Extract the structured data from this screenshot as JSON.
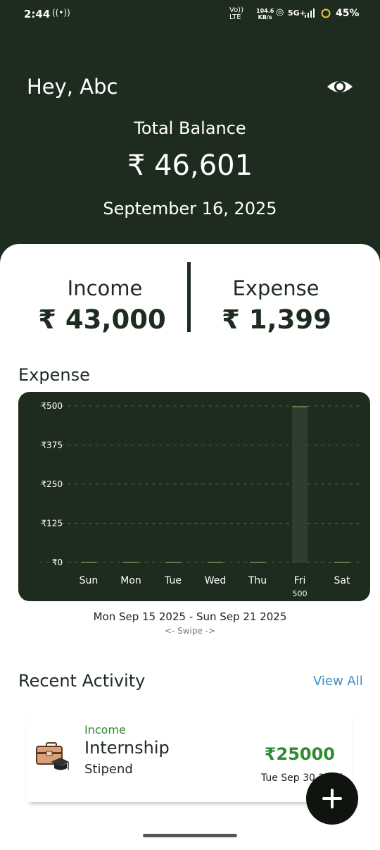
{
  "status_bar": {
    "time": "2:44",
    "network_top": "Vo))",
    "network_bottom": "LTE",
    "speed_top": "104.6",
    "speed_bottom": "KB/s",
    "network_type": "5G+",
    "battery": "45%",
    "icons": [
      "cast-icon",
      "hotspot-icon",
      "signal-bars-icon",
      "battery-ring-icon"
    ]
  },
  "header": {
    "greeting": "Hey, Abc",
    "total_balance_label": "Total Balance",
    "total_balance": "₹ 46,601",
    "date": "September 16, 2025",
    "icon": "eye-icon"
  },
  "summary": {
    "income_label": "Income",
    "income_amount": "₹ 43,000",
    "expense_label": "Expense",
    "expense_amount": "₹ 1,399"
  },
  "expense_section": {
    "title": "Expense",
    "week_range": "Mon Sep 15 2025 - Sun Sep 21 2025",
    "swipe_hint": "<- Swipe ->"
  },
  "chart_data": {
    "type": "bar",
    "categories": [
      "Sun",
      "Mon",
      "Tue",
      "Wed",
      "Thu",
      "Fri",
      "Sat"
    ],
    "values": [
      0,
      0,
      0,
      0,
      0,
      500,
      0
    ],
    "y_ticks": [
      "₹0",
      "₹125",
      "₹250",
      "₹375",
      "₹500"
    ],
    "y_tick_values": [
      0,
      125,
      250,
      375,
      500
    ],
    "ylim": [
      0,
      500
    ],
    "value_labels": {
      "Fri": "500"
    },
    "grid": true,
    "colors": {
      "background": "#1e2b1f",
      "bar": "#5e7a4a",
      "grid": "#4e5c4e",
      "text": "#ffffff"
    }
  },
  "recent_activity": {
    "title": "Recent Activity",
    "view_all": "View All",
    "items": [
      {
        "type": "Income",
        "title": "Internship",
        "subtitle": "Stipend",
        "amount": "₹25000",
        "date": "Tue Sep 30 2025",
        "icon": "briefcase-graduation-icon"
      }
    ]
  },
  "fab": {
    "icon": "plus-icon"
  },
  "colors": {
    "primary_dark": "#1e2b1f",
    "income_green": "#2e8b2e",
    "link_blue": "#3b8fc4"
  }
}
